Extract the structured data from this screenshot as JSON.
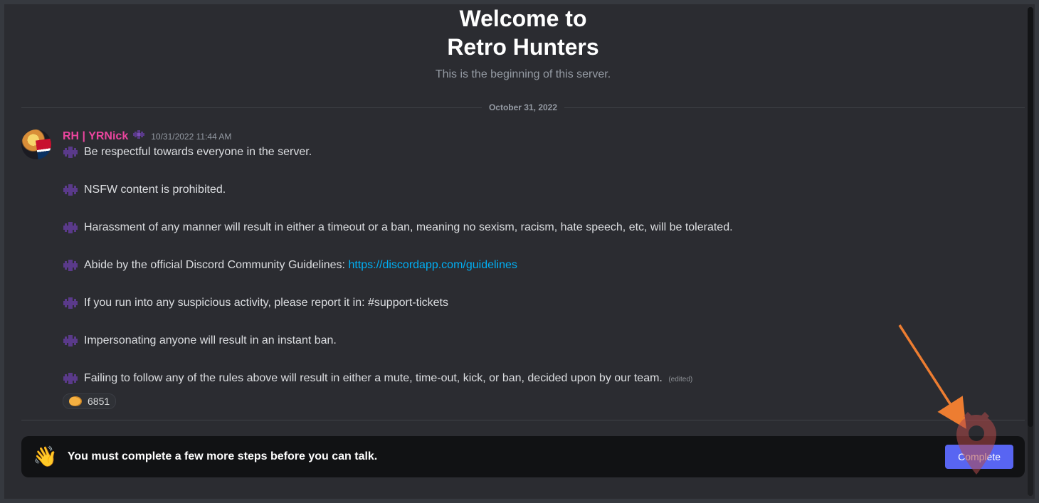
{
  "welcome": {
    "line1": "Welcome to",
    "line2": "Retro Hunters",
    "sub": "This is the beginning of this server."
  },
  "date_divider": "October 31, 2022",
  "message": {
    "author": "RH | YRNick",
    "timestamp": "10/31/2022 11:44 AM",
    "rules": {
      "r1": "Be respectful towards everyone in the server.",
      "r2": "NSFW content is prohibited.",
      "r3": "Harassment of any manner will result in either a timeout or a ban, meaning no sexism, racism, hate speech, etc, will be tolerated.",
      "r4_pre": "Abide by the official Discord Community Guidelines: ",
      "r4_link": "https://discordapp.com/guidelines",
      "r5": "If you run into any suspicious activity, please report it in: #support-tickets",
      "r6": "Impersonating anyone will result in an instant ban.",
      "r7": "Failing to follow any of the rules above will result in either a mute, time-out, kick, or ban, decided upon by our team."
    },
    "edited_label": "(edited)",
    "reaction_count": "6851"
  },
  "steps_bar": {
    "wave_emoji": "👋",
    "text": "You must complete a few more steps before you can talk.",
    "button": "Complete"
  }
}
